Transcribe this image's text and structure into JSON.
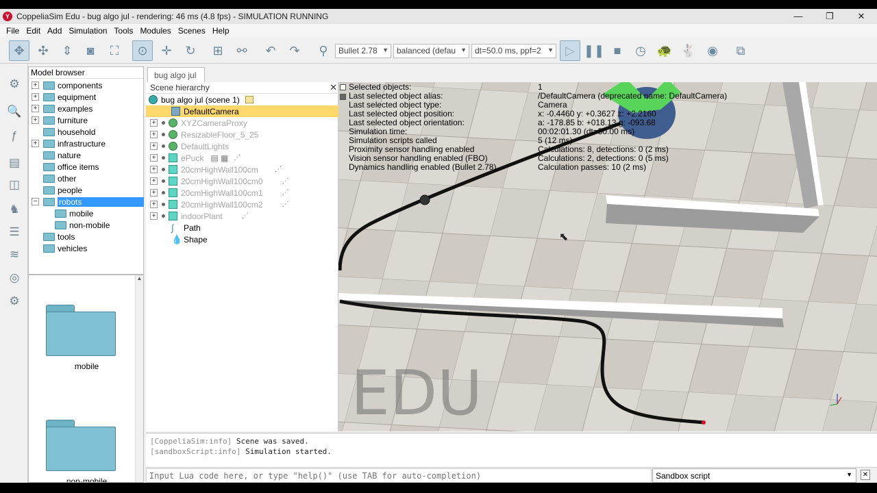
{
  "window": {
    "title": "CoppeliaSim Edu - bug algo jul - rendering: 46 ms (4.8 fps) - SIMULATION RUNNING",
    "logo_glyph": "Y",
    "minimize": "—",
    "restore": "❐",
    "close": "✕"
  },
  "menu": [
    "File",
    "Edit",
    "Add",
    "Simulation",
    "Tools",
    "Modules",
    "Scenes",
    "Help"
  ],
  "toolbar": {
    "physics_engine": "Bullet 2.78",
    "accuracy": "balanced (defau",
    "timestep": "dt=50.0 ms, ppf=2",
    "icons": [
      "camera-pan-icon",
      "camera-rotate-icon",
      "camera-shift-icon",
      "camera-angle-icon",
      "fit-to-view-icon",
      "click-select-icon",
      "object-shift-icon",
      "object-rotate-icon",
      "assemble-icon",
      "transfer-dna-icon",
      "undo-icon",
      "redo-icon",
      "dynamics-engine-icon",
      "play-icon",
      "pause-icon",
      "stop-icon",
      "realtime-icon",
      "slow-down-icon",
      "speed-up-icon",
      "visualization-icon",
      "page-layout-icon"
    ],
    "accent_color": "#6a8aa0"
  },
  "model_browser": {
    "header": "Model browser",
    "items": [
      {
        "label": "components",
        "expandable": true
      },
      {
        "label": "equipment",
        "expandable": true
      },
      {
        "label": "examples",
        "expandable": true
      },
      {
        "label": "furniture",
        "expandable": true
      },
      {
        "label": "household",
        "expandable": false
      },
      {
        "label": "infrastructure",
        "expandable": true
      },
      {
        "label": "nature",
        "expandable": false
      },
      {
        "label": "office items",
        "expandable": false
      },
      {
        "label": "other",
        "expandable": false
      },
      {
        "label": "people",
        "expandable": false
      },
      {
        "label": "robots",
        "expandable": true,
        "expanded": true,
        "selected": true
      },
      {
        "label": "mobile",
        "child": true
      },
      {
        "label": "non-mobile",
        "child": true
      },
      {
        "label": "tools",
        "expandable": false
      },
      {
        "label": "vehicles",
        "expandable": false
      }
    ],
    "thumbnails": [
      "mobile",
      "non-mobile"
    ]
  },
  "scene_tab": "bug algo jul",
  "hierarchy": {
    "header": "Scene hierarchy",
    "close": "✕",
    "root": "bug algo jul (scene 1)",
    "items": [
      {
        "label": "DefaultCamera",
        "selected": true,
        "icon": "camera-icon"
      },
      {
        "label": "XYZCameraProxy",
        "icon": "shape-icon",
        "dim": true
      },
      {
        "label": "ResizableFloor_5_25",
        "icon": "shape-icon",
        "dim": true
      },
      {
        "label": "DefaultLights",
        "icon": "shape-icon",
        "dim": true
      },
      {
        "label": "ePuck",
        "icon": "cube-icon",
        "dim": true
      },
      {
        "label": "20cmHighWall100cm",
        "icon": "cube-icon",
        "dim": true
      },
      {
        "label": "20cmHighWall100cm0",
        "icon": "cube-icon",
        "dim": true
      },
      {
        "label": "20cmHighWall100cm1",
        "icon": "cube-icon",
        "dim": true
      },
      {
        "label": "20cmHighWall100cm2",
        "icon": "cube-icon",
        "dim": true
      },
      {
        "label": "indoorPlant",
        "icon": "cube-icon",
        "dim": true
      },
      {
        "label": "Path",
        "icon": "path-icon",
        "dim": false
      },
      {
        "label": "Shape",
        "icon": "drop-icon",
        "dim": false
      }
    ]
  },
  "viewport": {
    "watermark": "EDU",
    "info_rows": [
      {
        "label": "Selected objects:",
        "value": "1"
      },
      {
        "label": "Last selected object alias:",
        "value": "/DefaultCamera   (deprecated name: DefaultCamera)"
      },
      {
        "label": "Last selected object type:",
        "value": "Camera"
      },
      {
        "label": "Last selected object position:",
        "value": "x: -0.4460   y: +0.3627   z: +2.2160"
      },
      {
        "label": "Last selected object orientation:",
        "value": "a: -178.85   b: +018.13   g: -093.68"
      },
      {
        "label": "Simulation time:",
        "value": "00:02:01.30 (dt=50.00 ms)"
      },
      {
        "label": "Simulation scripts called",
        "value": "5 (12 ms)"
      },
      {
        "label": "Proximity sensor handling enabled",
        "value": "Calculations: 8, detections: 0 (2 ms)"
      },
      {
        "label": "Vision sensor handling enabled (FBO)",
        "value": "Calculations: 2, detections: 0 (5 ms)"
      },
      {
        "label": "Dynamics handling enabled (Bullet 2.78)",
        "value": "Calculation passes: 10 (2 ms)"
      }
    ]
  },
  "console": [
    {
      "tag": "[CoppeliaSim:info]",
      "text": "Scene was saved."
    },
    {
      "tag": "[sandboxScript:info]",
      "text": "Simulation started."
    }
  ],
  "lua_input": {
    "placeholder": "Input Lua code here, or type \"help()\" (use TAB for auto-completion)"
  },
  "script_selector": {
    "value": "Sandbox script"
  }
}
